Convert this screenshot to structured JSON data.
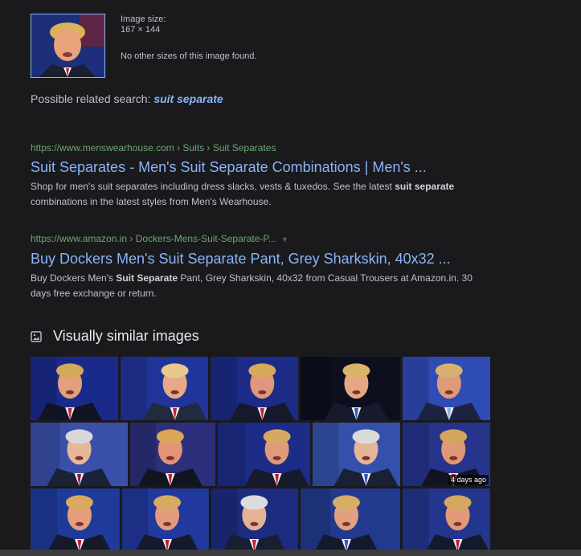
{
  "image_info": {
    "size_label": "Image size:",
    "size_value": "167 × 144",
    "no_other_sizes": "No other sizes of this image found."
  },
  "related_search": {
    "prefix": "Possible related search: ",
    "query": "suit separate"
  },
  "results": [
    {
      "url": "https://www.menswearhouse.com › Suits › Suit Separates",
      "title": "Suit Separates - Men's Suit Separate Combinations | Men's ...",
      "snippet_1": "Shop for men's suit separates including dress slacks, vests & tuxedos. See the latest ",
      "snippet_bold": "suit separate",
      "snippet_2": " combinations in the latest styles from Men's Wearhouse."
    },
    {
      "url": "https://www.amazon.in › Dockers-Mens-Suit-Separate-P...",
      "title": "Buy Dockers Men's Suit Separate Pant, Grey Sharkskin, 40x32 ...",
      "snippet_1": "Buy Dockers Men's ",
      "snippet_bold": "Suit Separate",
      "snippet_2": " Pant, Grey Sharkskin, 40x32 from Casual Trousers at Amazon.in. 30 days free exchange or return."
    }
  ],
  "visually_similar": {
    "heading": "Visually similar images",
    "badge": "4 days ago"
  },
  "colors": {
    "background": "#1a1a1d",
    "link": "#8ab4f8",
    "url_green": "#6fa66f",
    "text": "#bdc1c6"
  }
}
